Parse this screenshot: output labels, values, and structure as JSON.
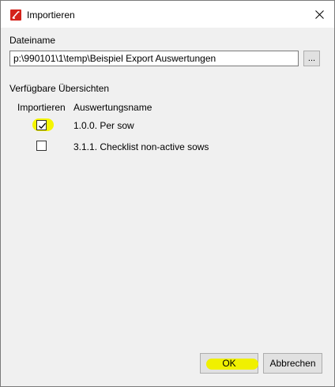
{
  "window": {
    "title": "Importieren"
  },
  "file": {
    "label": "Dateiname",
    "path_value": "p:\\990101\\1\\temp\\Beispiel Export Auswertungen",
    "browse_label": "..."
  },
  "overview": {
    "section_label": "Verfügbare Übersichten",
    "columns": {
      "import": "Importieren",
      "name": "Auswertungsname"
    },
    "rows": [
      {
        "name": "1.0.0. Per sow",
        "checked": true
      },
      {
        "name": "3.1.1. Checklist non-active sows",
        "checked": false
      }
    ]
  },
  "buttons": {
    "ok": "OK",
    "cancel": "Abbrechen"
  },
  "colors": {
    "highlight": "#f0f000",
    "app_icon": "#d4231b"
  }
}
